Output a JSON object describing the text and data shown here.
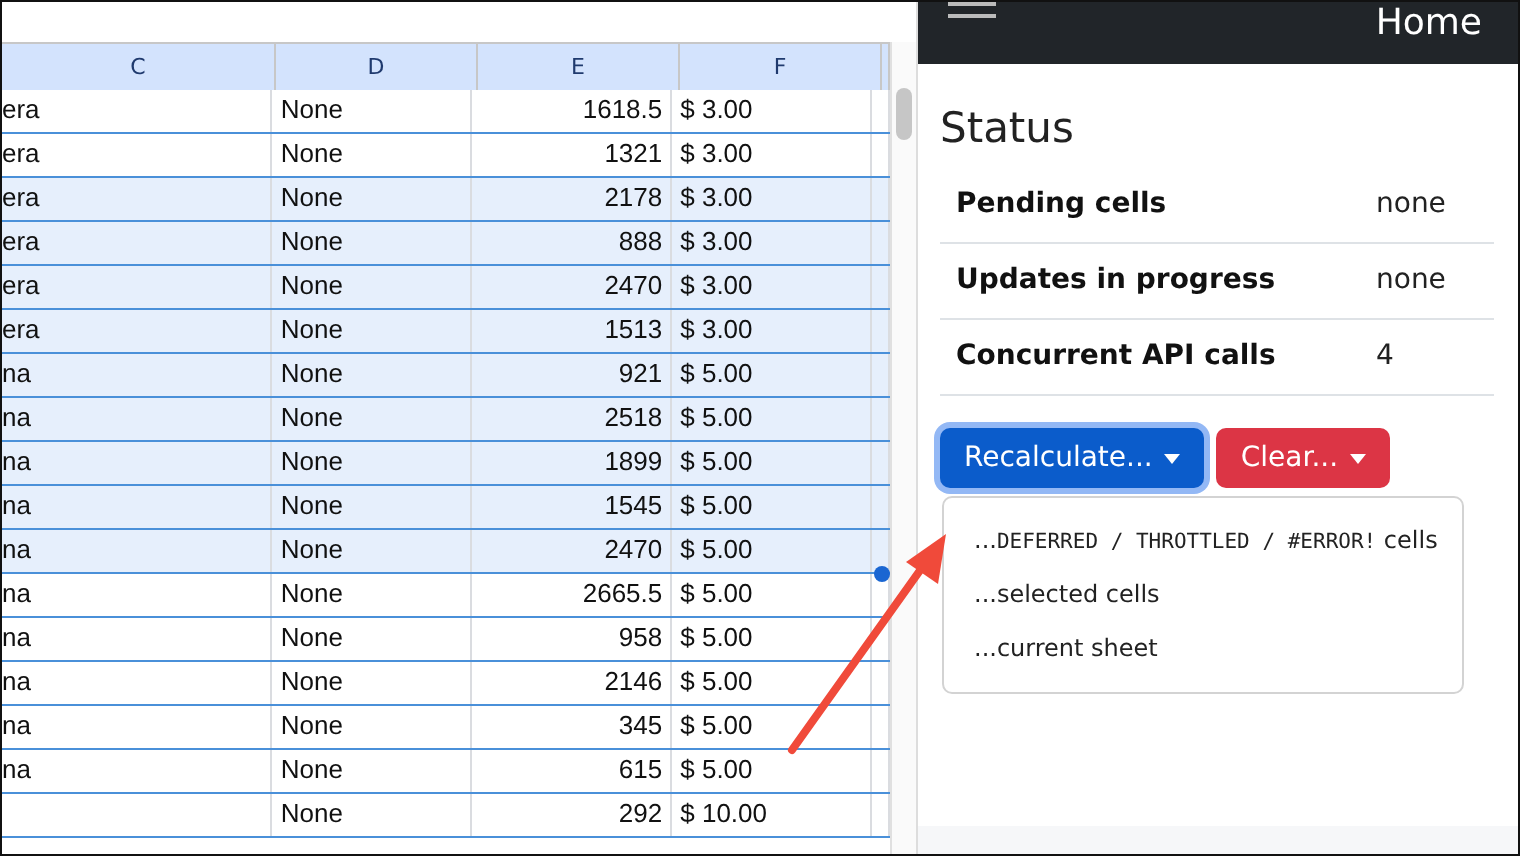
{
  "sheet": {
    "columns": [
      "C",
      "D",
      "E",
      "F"
    ],
    "rows": [
      {
        "cells": [
          "era",
          "None",
          "1618.5",
          "$ 3.00"
        ],
        "selected": false
      },
      {
        "cells": [
          "era",
          "None",
          "1321",
          "$ 3.00"
        ],
        "selected": false
      },
      {
        "cells": [
          "era",
          "None",
          "2178",
          "$ 3.00"
        ],
        "selected": true
      },
      {
        "cells": [
          "era",
          "None",
          "888",
          "$ 3.00"
        ],
        "selected": true
      },
      {
        "cells": [
          "era",
          "None",
          "2470",
          "$ 3.00"
        ],
        "selected": true
      },
      {
        "cells": [
          "era",
          "None",
          "1513",
          "$ 3.00"
        ],
        "selected": true
      },
      {
        "cells": [
          "na",
          "None",
          "921",
          "$ 5.00"
        ],
        "selected": true
      },
      {
        "cells": [
          "na",
          "None",
          "2518",
          "$ 5.00"
        ],
        "selected": true
      },
      {
        "cells": [
          "na",
          "None",
          "1899",
          "$ 5.00"
        ],
        "selected": true
      },
      {
        "cells": [
          "na",
          "None",
          "1545",
          "$ 5.00"
        ],
        "selected": true
      },
      {
        "cells": [
          "na",
          "None",
          "2470",
          "$ 5.00"
        ],
        "selected": true
      },
      {
        "cells": [
          "na",
          "None",
          "2665.5",
          "$ 5.00"
        ],
        "selected": false
      },
      {
        "cells": [
          "na",
          "None",
          "958",
          "$ 5.00"
        ],
        "selected": false
      },
      {
        "cells": [
          "na",
          "None",
          "2146",
          "$ 5.00"
        ],
        "selected": false
      },
      {
        "cells": [
          "na",
          "None",
          "345",
          "$ 5.00"
        ],
        "selected": false
      },
      {
        "cells": [
          "na",
          "None",
          "615",
          "$ 5.00"
        ],
        "selected": false
      },
      {
        "cells": [
          "",
          "None",
          "292",
          "$ 10.00"
        ],
        "selected": false
      }
    ]
  },
  "navbar": {
    "title": "Home"
  },
  "status": {
    "title": "Status",
    "rows": [
      {
        "label": "Pending cells",
        "value": "none"
      },
      {
        "label": "Updates in progress",
        "value": "none"
      },
      {
        "label": "Concurrent API calls",
        "value": "4"
      }
    ]
  },
  "buttons": [
    {
      "label": "Recalculate...",
      "kind": "primary",
      "expanded": true
    },
    {
      "label": "Clear...",
      "kind": "danger",
      "expanded": false
    }
  ],
  "menu": [
    {
      "parts": [
        {
          "kind": "text",
          "text": "..."
        },
        {
          "kind": "code",
          "text": "DEFERRED / THROTTLED / #ERROR!"
        },
        {
          "kind": "text",
          "text": " cells"
        }
      ]
    },
    {
      "parts": [
        {
          "kind": "text",
          "text": "...selected cells"
        }
      ]
    },
    {
      "parts": [
        {
          "kind": "text",
          "text": "...current sheet"
        }
      ]
    }
  ]
}
